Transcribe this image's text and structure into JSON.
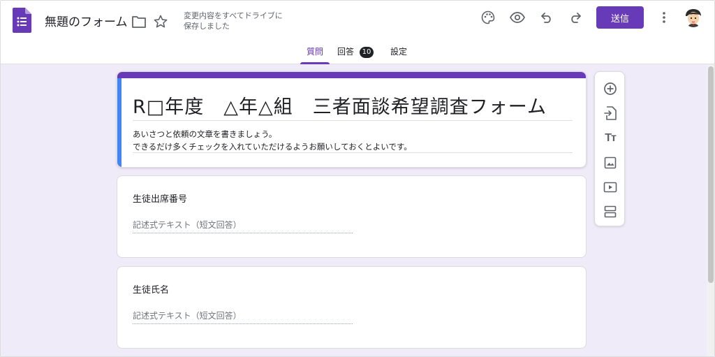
{
  "header": {
    "doc_title": "無題のフォーム",
    "save_status_line1": "変更内容をすべてドライブに",
    "save_status_line2": "保存しました",
    "send_label": "送信"
  },
  "tabs": {
    "questions": "質問",
    "responses": "回答",
    "responses_count": "10",
    "settings": "設定"
  },
  "form": {
    "title": "R□年度　△年△組　三者面談希望調査フォーム",
    "description_line1": "あいさつと依頼の文章を書きましょう。",
    "description_line2": "できるだけ多くチェックを入れていただけるようお願いしておくとよいです。"
  },
  "questions": [
    {
      "title": "生徒出席番号",
      "placeholder": "記述式テキスト（短文回答）"
    },
    {
      "title": "生徒氏名",
      "placeholder": "記述式テキスト（短文回答）"
    }
  ],
  "toolbar": {
    "add_question": "add-circle-icon",
    "import_questions": "import-icon",
    "add_title": "Tт",
    "add_image": "image-icon",
    "add_video": "video-icon",
    "add_section": "section-icon"
  },
  "colors": {
    "accent": "#673ab7",
    "background": "#f0ebf8",
    "title_left_bar": "#4285f4"
  }
}
